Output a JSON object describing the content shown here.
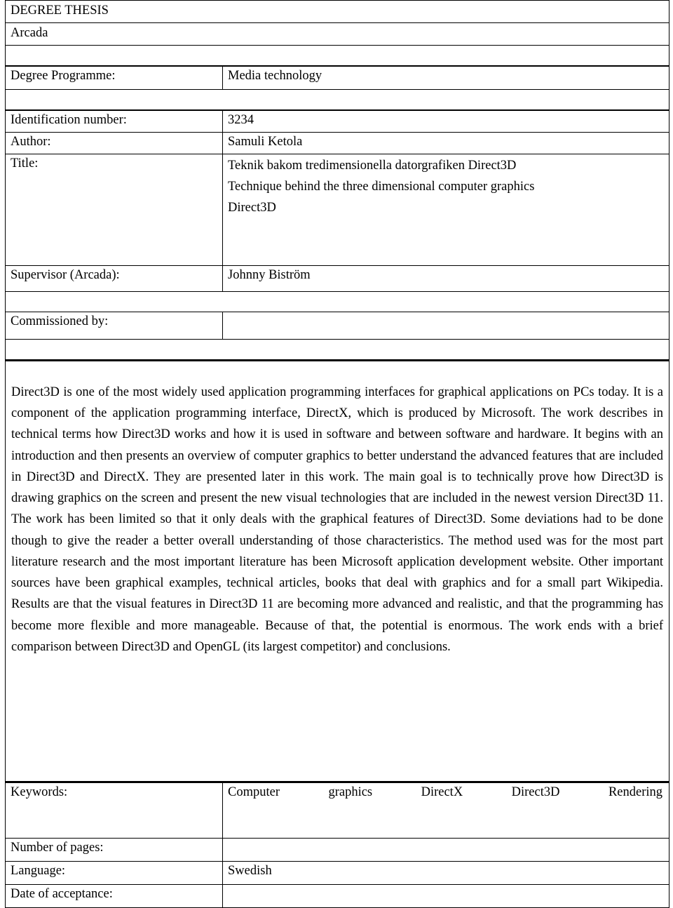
{
  "document": {
    "heading": "DEGREE THESIS",
    "institution": "Arcada"
  },
  "fields": {
    "degree_programme": {
      "label": "Degree Programme:",
      "value": "Media technology"
    },
    "identification_number": {
      "label": "Identification number:",
      "value": "3234"
    },
    "author": {
      "label": "Author:",
      "value": "Samuli Ketola"
    },
    "title": {
      "label": "Title:",
      "line1": "Teknik bakom tredimensionella datorgrafiken Direct3D",
      "line2": "Technique behind the three dimensional computer graphics",
      "line3": "Direct3D"
    },
    "supervisor": {
      "label": "Supervisor (Arcada):",
      "value": "Johnny Biström"
    },
    "commissioned_by": {
      "label": "Commissioned by:",
      "value": ""
    },
    "keywords": {
      "label": "Keywords:",
      "value": "Computer graphics DirectX Direct3D Rendering"
    },
    "number_of_pages": {
      "label": "Number of pages:",
      "value": ""
    },
    "language": {
      "label": "Language:",
      "value": "Swedish"
    },
    "date_of_acceptance": {
      "label": "Date of acceptance:",
      "value": ""
    }
  },
  "abstract": {
    "text": "Direct3D is one of the most widely used application programming interfaces for graphical applications on PCs today.  It is a component of the application programming interface, DirectX, which is produced by Microsoft. The work describes in technical terms how Direct3D works and how it is used in software and between software and hardware. It begins with an introduction and then presents an overview of computer graphics to better understand the advanced features that are included in Direct3D and DirectX. They are presented later in this work. The main goal is to technically prove how Direct3D is drawing graphics on the screen and present the new visual technologies that are included in the newest version Direct3D 11. The work has been limited so that it only deals with the graphical features of Direct3D. Some deviations had to be done though to give the reader a better overall understanding of those characteristics. The method used was for the most part literature research and the most important literature has been Microsoft application development website. Other important sources have been graphical examples, technical articles, books that deal with graphics and for a small part Wikipedia. Results are that the visual features in Direct3D 11 are becoming more advanced and realistic, and that the programming has become more flexible and more manageable. Because of that, the potential is enormous. The work ends with a brief comparison between Direct3D and OpenGL (its largest competitor) and conclusions."
  }
}
